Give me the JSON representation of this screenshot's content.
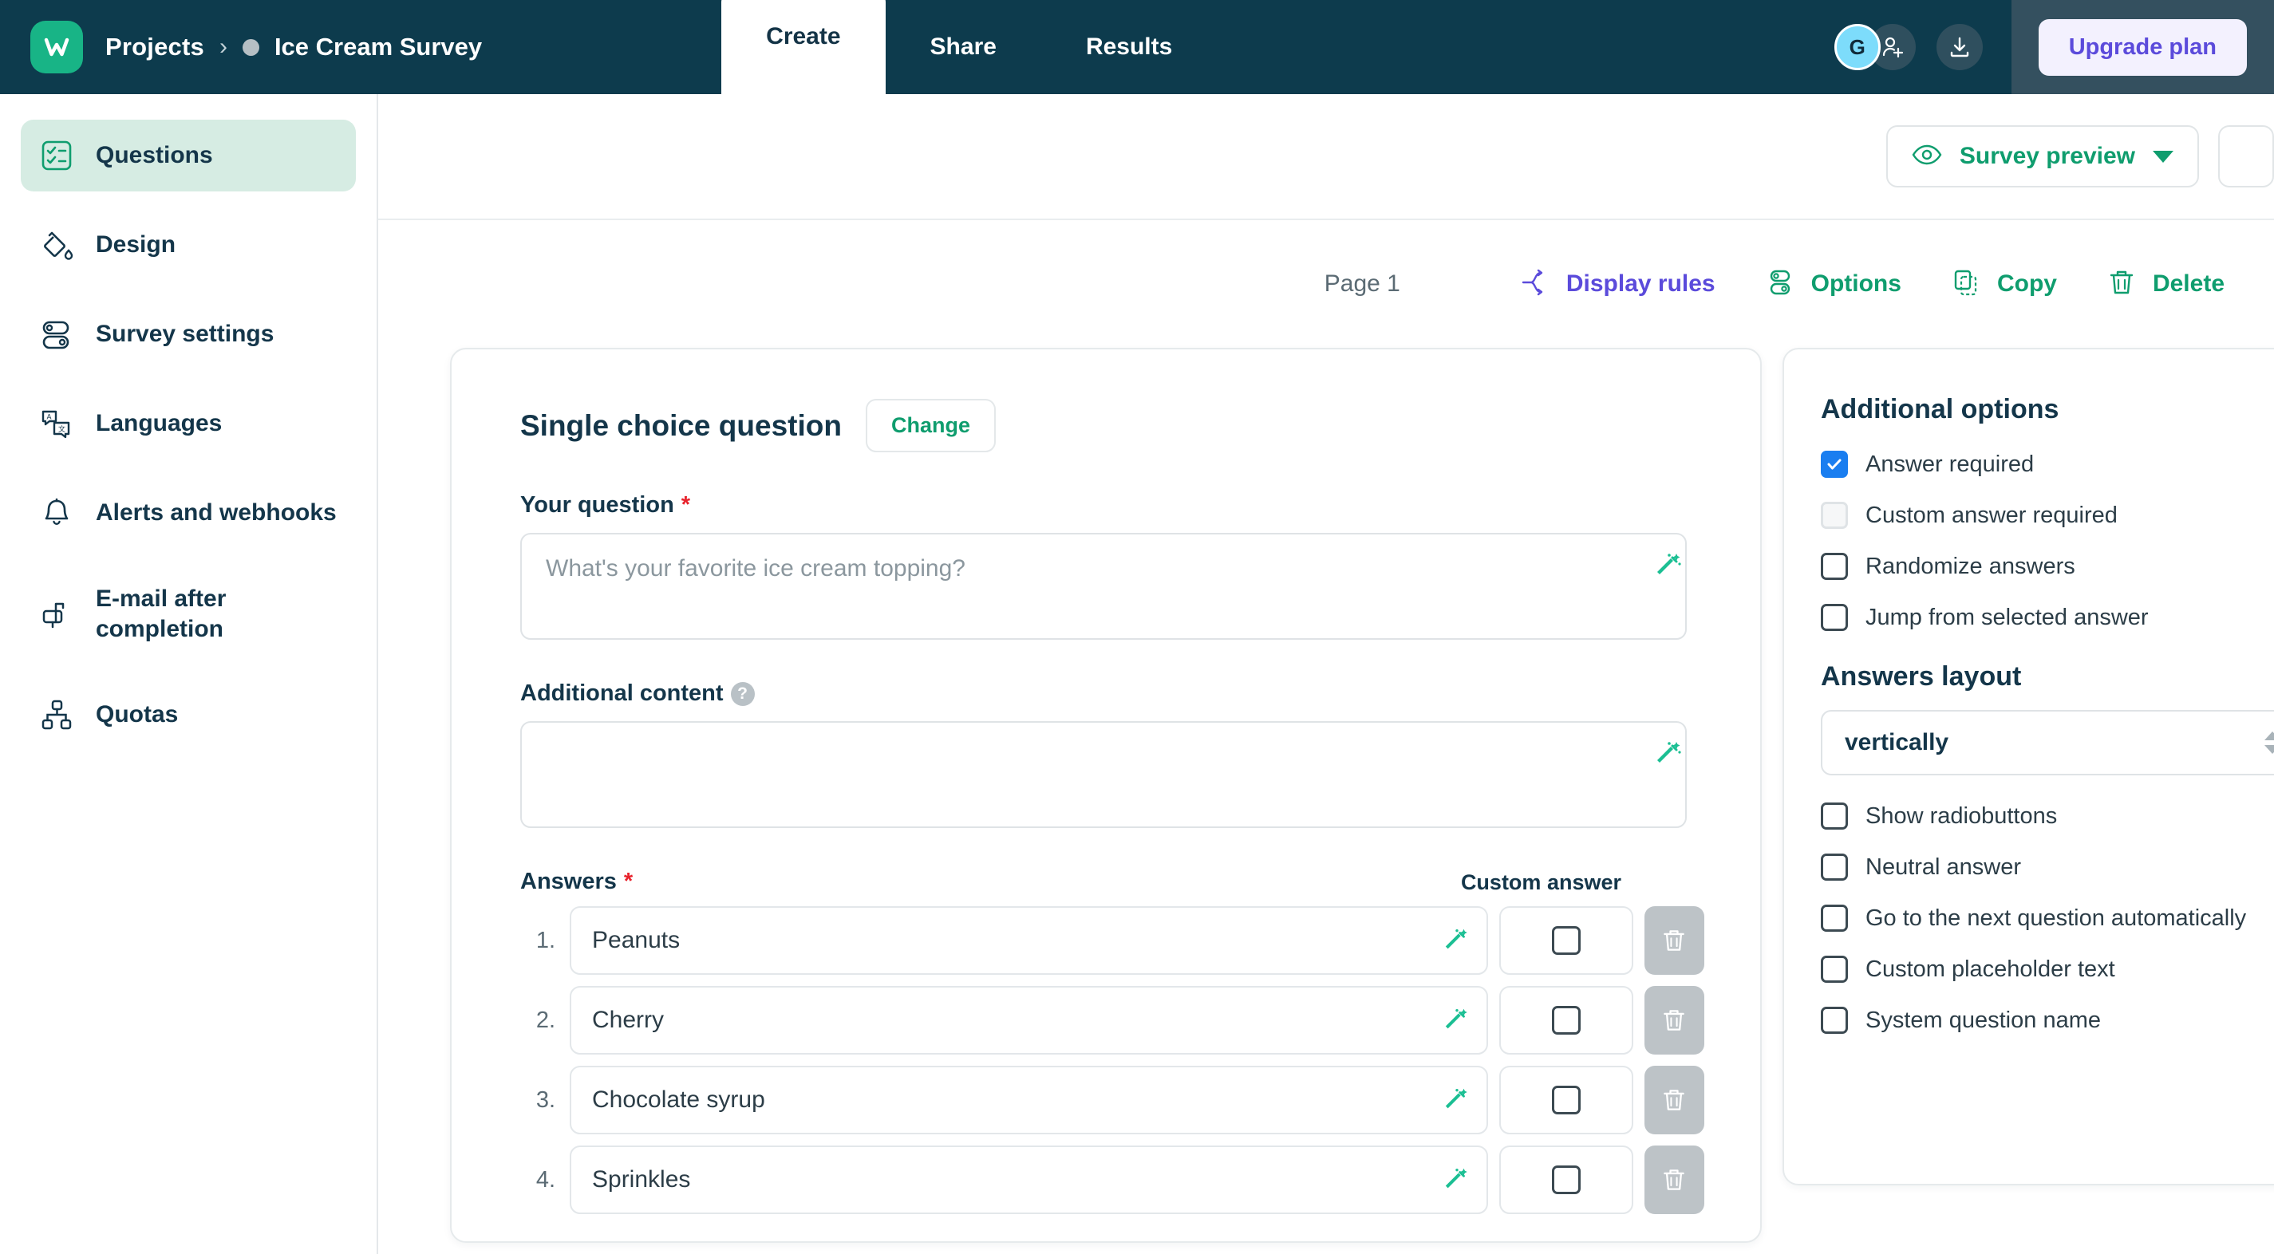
{
  "header": {
    "logo_letter": "W",
    "breadcrumb": {
      "root": "Projects",
      "separator": "›",
      "current": "Ice Cream Survey"
    },
    "tabs": [
      {
        "label": "Create",
        "active": true
      },
      {
        "label": "Share",
        "active": false
      },
      {
        "label": "Results",
        "active": false
      }
    ],
    "avatar_initial": "G",
    "add_user_icon": "add-user-icon",
    "download_icon": "download-icon",
    "upgrade_label": "Upgrade plan"
  },
  "sidebar": {
    "items": [
      {
        "label": "Questions",
        "icon": "checklist-icon",
        "active": true
      },
      {
        "label": "Design",
        "icon": "paint-bucket-icon",
        "active": false
      },
      {
        "label": "Survey settings",
        "icon": "toggles-icon",
        "active": false
      },
      {
        "label": "Languages",
        "icon": "translate-icon",
        "active": false
      },
      {
        "label": "Alerts and webhooks",
        "icon": "bell-icon",
        "active": false
      },
      {
        "label": "E-mail after completion",
        "icon": "mailbox-icon",
        "active": false
      },
      {
        "label": "Quotas",
        "icon": "hierarchy-icon",
        "active": false
      }
    ]
  },
  "toolbar": {
    "preview_label": "Survey preview",
    "eye_icon": "eye-icon",
    "caret_icon": "chevron-down-icon"
  },
  "page_toolbar": {
    "page_label": "Page 1",
    "actions": [
      {
        "label": "Display rules",
        "icon": "branch-icon",
        "color": "purple"
      },
      {
        "label": "Options",
        "icon": "toggles-icon",
        "color": "green"
      },
      {
        "label": "Copy",
        "icon": "copy-icon",
        "color": "green"
      },
      {
        "label": "Delete",
        "icon": "trash-icon",
        "color": "green"
      }
    ]
  },
  "question_card": {
    "type_title": "Single choice question",
    "change_label": "Change",
    "question_label": "Your question",
    "question_required_mark": "*",
    "question_value": "",
    "question_placeholder": "What's your favorite ice cream topping?",
    "additional_label": "Additional content",
    "additional_help_icon": "help-icon",
    "additional_value": "",
    "additional_placeholder": "",
    "answers_label": "Answers",
    "answers_required_mark": "*",
    "custom_answer_header": "Custom answer",
    "wand_icon": "magic-wand-icon",
    "trash_icon": "trash-icon",
    "answers": [
      {
        "number": "1.",
        "value": "Peanuts",
        "custom_checked": false
      },
      {
        "number": "2.",
        "value": "Cherry",
        "custom_checked": false
      },
      {
        "number": "3.",
        "value": "Chocolate syrup",
        "custom_checked": false
      },
      {
        "number": "4.",
        "value": "Sprinkles",
        "custom_checked": false
      }
    ]
  },
  "options_panel": {
    "title": "Additional options",
    "options": [
      {
        "label": "Answer required",
        "checked": true,
        "disabled": false
      },
      {
        "label": "Custom answer required",
        "checked": false,
        "disabled": true
      },
      {
        "label": "Randomize answers",
        "checked": false,
        "disabled": false
      },
      {
        "label": "Jump from selected answer",
        "checked": false,
        "disabled": false
      }
    ],
    "layout_title": "Answers layout",
    "layout_value": "vertically",
    "options2": [
      {
        "label": "Show radiobuttons",
        "checked": false,
        "disabled": false
      },
      {
        "label": "Neutral answer",
        "checked": false,
        "disabled": false
      },
      {
        "label": "Go to the next question automatically",
        "checked": false,
        "disabled": false
      },
      {
        "label": "Custom placeholder text",
        "checked": false,
        "disabled": false
      },
      {
        "label": "System question name",
        "checked": false,
        "disabled": false
      }
    ]
  },
  "colors": {
    "header_bg": "#0d3b4d",
    "brand_green": "#18b486",
    "accent_green": "#0f9d6e",
    "accent_purple": "#5b4bdb",
    "checkbox_blue": "#1a7ef0",
    "required_red": "#e8222c"
  }
}
